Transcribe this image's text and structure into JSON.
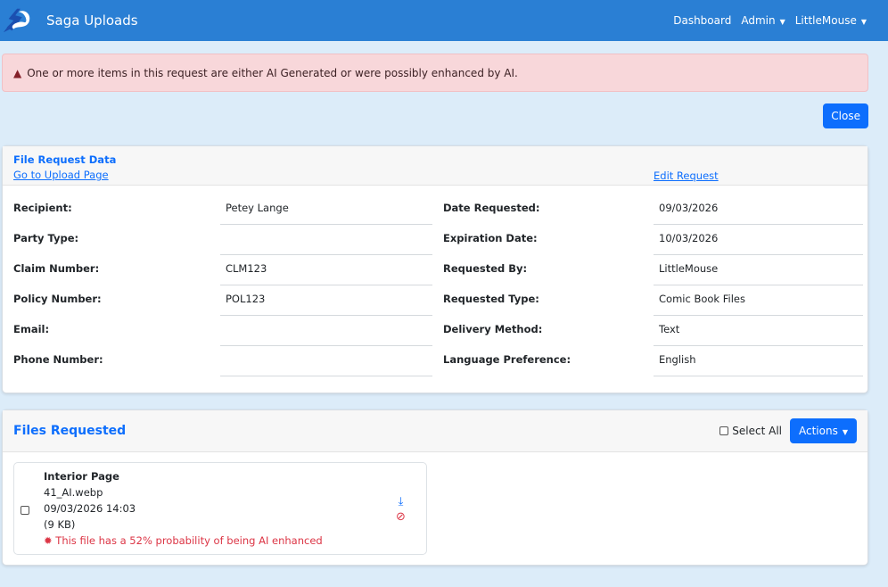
{
  "nav": {
    "brand": "Saga Uploads",
    "items": [
      {
        "label": "Dashboard",
        "has_caret": false
      },
      {
        "label": "Admin",
        "has_caret": true
      },
      {
        "label": "LittleMouse",
        "has_caret": true
      }
    ],
    "color": "#2a7fd4"
  },
  "alert": {
    "icon": "warning-triangle-icon",
    "message": "One or more items in this request are either AI Generated or were possibly enhanced by AI."
  },
  "close_label": "Close",
  "request": {
    "title": "File Request Data",
    "upload_link": "Go to Upload Page",
    "edit_link": "Edit Request",
    "left_fields": [
      {
        "label": "Recipient:",
        "value": "Petey Lange"
      },
      {
        "label": "Party Type:",
        "value": ""
      },
      {
        "label": "Claim Number:",
        "value": "CLM123"
      },
      {
        "label": "Policy Number:",
        "value": "POL123"
      },
      {
        "label": "Email:",
        "value": ""
      },
      {
        "label": "Phone Number:",
        "value": ""
      }
    ],
    "right_fields": [
      {
        "label": "Date Requested:",
        "value": "09/03/2026"
      },
      {
        "label": "Expiration Date:",
        "value": "10/03/2026"
      },
      {
        "label": "Requested By:",
        "value": "LittleMouse"
      },
      {
        "label": "Requested Type:",
        "value": "Comic Book Files"
      },
      {
        "label": "Delivery Method:",
        "value": "Text"
      },
      {
        "label": "Language Preference:",
        "value": "English"
      }
    ]
  },
  "files": {
    "title": "Files Requested",
    "select_all": "Select All",
    "actions": "Actions",
    "items": [
      {
        "type": "Interior Page",
        "filename": "41_AI.webp",
        "datetime": "09/03/2026 14:03",
        "size": "(9 KB)",
        "ai_warning": "This file has a 52% probability of being AI enhanced"
      }
    ]
  }
}
